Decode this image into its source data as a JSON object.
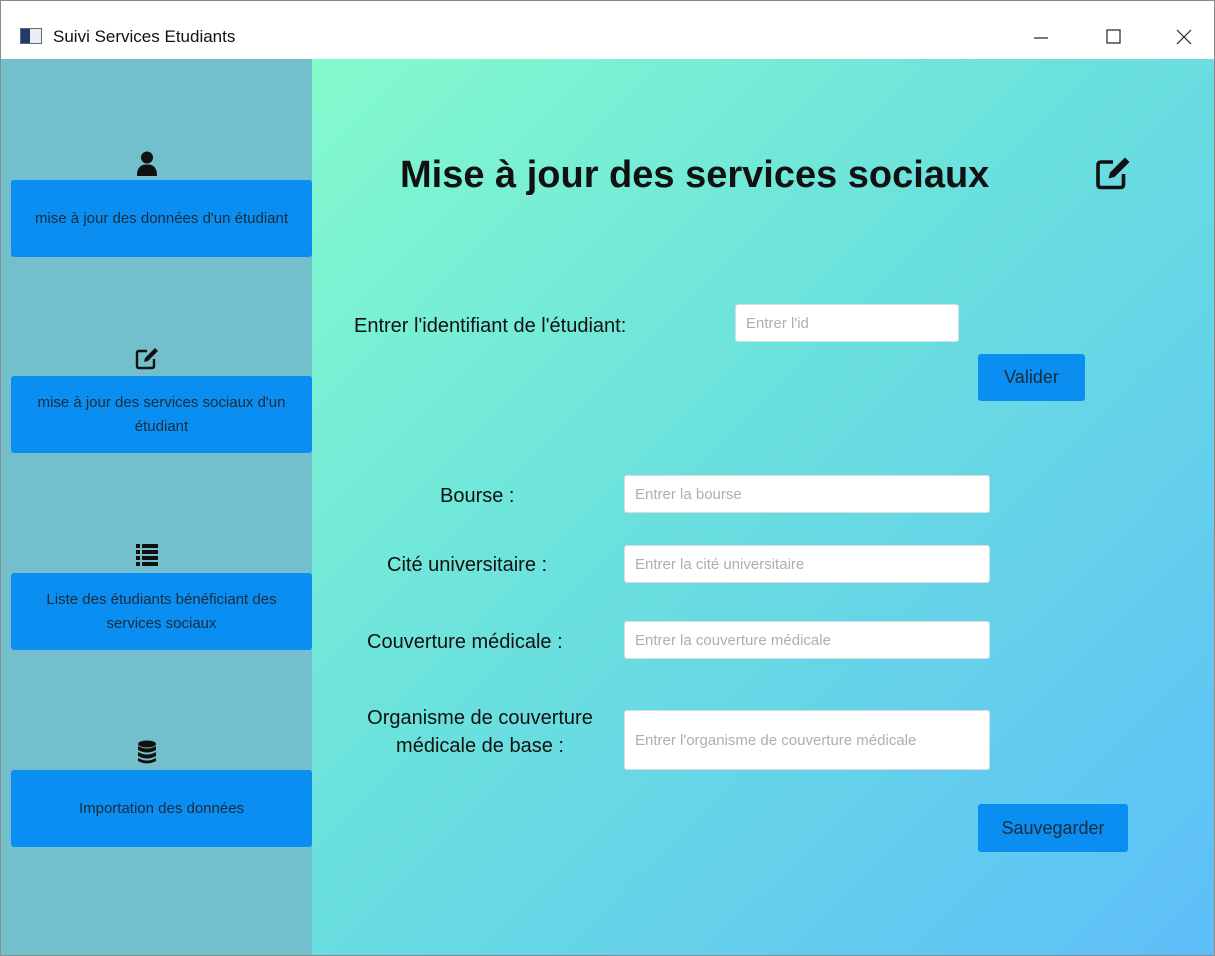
{
  "window": {
    "title": "Suivi Services Etudiants",
    "controls": [
      "minimize",
      "maximize",
      "close"
    ]
  },
  "sidebar": {
    "items": [
      {
        "icon": "user-icon",
        "label": "mise à jour des données d'un étudiant"
      },
      {
        "icon": "edit-icon",
        "label": "mise à jour des services sociaux d'un étudiant"
      },
      {
        "icon": "list-icon",
        "label": "Liste des étudiants bénéficiant des services sociaux"
      },
      {
        "icon": "database-icon",
        "label": "Importation des données"
      }
    ]
  },
  "main": {
    "title": "Mise à jour des services sociaux",
    "title_icon": "edit-icon",
    "id_label": "Entrer l'identifiant de l'étudiant:",
    "id_placeholder": "Entrer l'id",
    "validate_label": "Valider",
    "fields": [
      {
        "label": "Bourse :",
        "placeholder": "Entrer la bourse"
      },
      {
        "label": "Cité universitaire :",
        "placeholder": "Entrer la cité universitaire"
      },
      {
        "label": "Couverture médicale :",
        "placeholder": "Entrer la couverture médicale"
      },
      {
        "label": "Organisme de couverture médicale de base :",
        "placeholder": "Entrer l'organisme de couverture médicale"
      }
    ],
    "save_label": "Sauvegarder"
  },
  "colors": {
    "sidebar_bg": "#73bfcb",
    "button_bg": "#0a8ef2",
    "gradient_start": "#84fbcc",
    "gradient_end": "#5ebef9"
  }
}
